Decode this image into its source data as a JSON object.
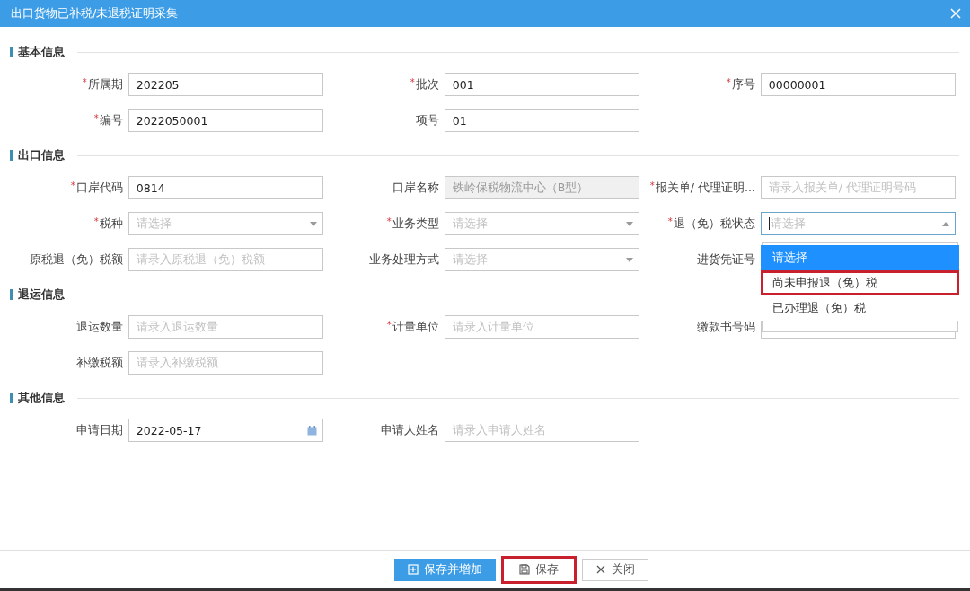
{
  "window": {
    "title": "出口货物已补税/未退税证明采集"
  },
  "sections": [
    {
      "title": "基本信息",
      "rows": [
        [
          {
            "label": "所属期",
            "marker": "*",
            "kind": "text",
            "value": "202205"
          },
          {
            "label": "批次",
            "marker": "*",
            "kind": "text",
            "value": "001"
          },
          {
            "label": "序号",
            "marker": "*",
            "kind": "text",
            "value": "00000001"
          }
        ],
        [
          {
            "label": "编号",
            "marker": "*",
            "kind": "text",
            "value": "2022050001"
          },
          {
            "label": "项号",
            "kind": "text",
            "value": "01"
          }
        ]
      ]
    },
    {
      "title": "出口信息",
      "rows": [
        [
          {
            "label": "口岸代码",
            "marker": "*",
            "kind": "text",
            "value": "0814"
          },
          {
            "label": "口岸名称",
            "kind": "readonly",
            "value": "铁岭保税物流中心（B型）"
          },
          {
            "label": "报关单/ 代理证明...",
            "marker": "*",
            "kind": "text",
            "placeholder": "请录入报关单/ 代理证明号码"
          }
        ],
        [
          {
            "label": "税种",
            "marker": "*",
            "kind": "select",
            "placeholder": "请选择",
            "open": false
          },
          {
            "label": "业务类型",
            "marker": "*",
            "kind": "select",
            "placeholder": "请选择",
            "open": false
          },
          {
            "label": "退（免）税状态",
            "marker": "*",
            "kind": "select",
            "placeholder": "请选择",
            "open": true,
            "options": [
              {
                "label": "请选择",
                "selected": true,
                "highlighted": false
              },
              {
                "label": "尚未申报退（免）税",
                "selected": false,
                "highlighted": true
              },
              {
                "label": "已办理退（免）税",
                "selected": false,
                "highlighted": false
              }
            ]
          }
        ],
        [
          {
            "label": "原税退（免）税额",
            "kind": "text",
            "placeholder": "请录入原税退（免）税额"
          },
          {
            "label": "业务处理方式",
            "kind": "select",
            "placeholder": "请选择",
            "open": false
          },
          {
            "label": "进货凭证号",
            "kind": "text"
          }
        ]
      ]
    },
    {
      "title": "退运信息",
      "rows": [
        [
          {
            "label": "退运数量",
            "kind": "text",
            "placeholder": "请录入退运数量"
          },
          {
            "label": "计量单位",
            "marker": "*",
            "kind": "text",
            "placeholder": "请录入计量单位"
          },
          {
            "label": "缴款书号码",
            "kind": "text"
          }
        ],
        [
          {
            "label": "补缴税额",
            "kind": "text",
            "placeholder": "请录入补缴税额"
          }
        ]
      ]
    },
    {
      "title": "其他信息",
      "rows": [
        [
          {
            "label": "申请日期",
            "kind": "date",
            "value": "2022-05-17"
          },
          {
            "label": "申请人姓名",
            "kind": "text",
            "placeholder": "请录入申请人姓名"
          }
        ]
      ]
    }
  ],
  "buttons": [
    {
      "label": "保存并增加",
      "kind": "add",
      "highlighted": false
    },
    {
      "label": "保存",
      "kind": "save",
      "highlighted": true
    },
    {
      "label": "关闭",
      "kind": "close",
      "highlighted": false
    }
  ]
}
